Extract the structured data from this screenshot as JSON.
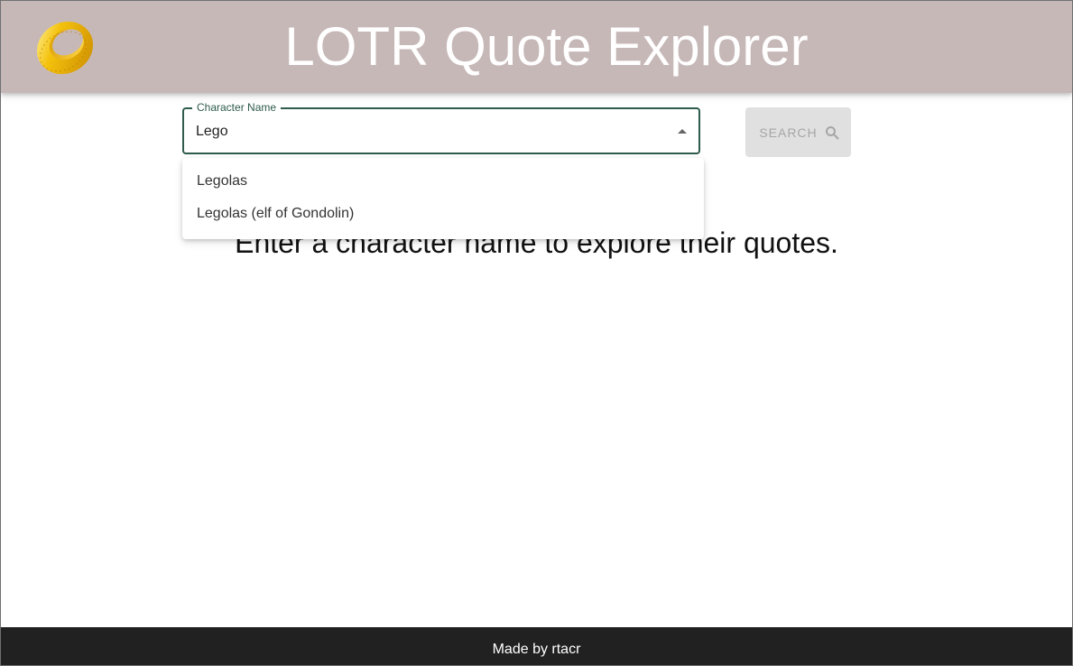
{
  "header": {
    "title": "LOTR Quote Explorer",
    "logo_icon": "ring-icon"
  },
  "search": {
    "label": "Character Name",
    "value": "Lego",
    "button_label": "SEARCH",
    "button_icon": "search-icon"
  },
  "autocomplete": {
    "options": [
      "Legolas",
      "Legolas (elf of Gondolin)"
    ]
  },
  "main": {
    "prompt": "Enter a character name to explore their quotes."
  },
  "footer": {
    "text": "Made by rtacr"
  },
  "colors": {
    "header_bg": "#c7b8b8",
    "accent": "#2e5b4c",
    "footer_bg": "#212121",
    "disabled_button_bg": "#e0e0e0"
  }
}
